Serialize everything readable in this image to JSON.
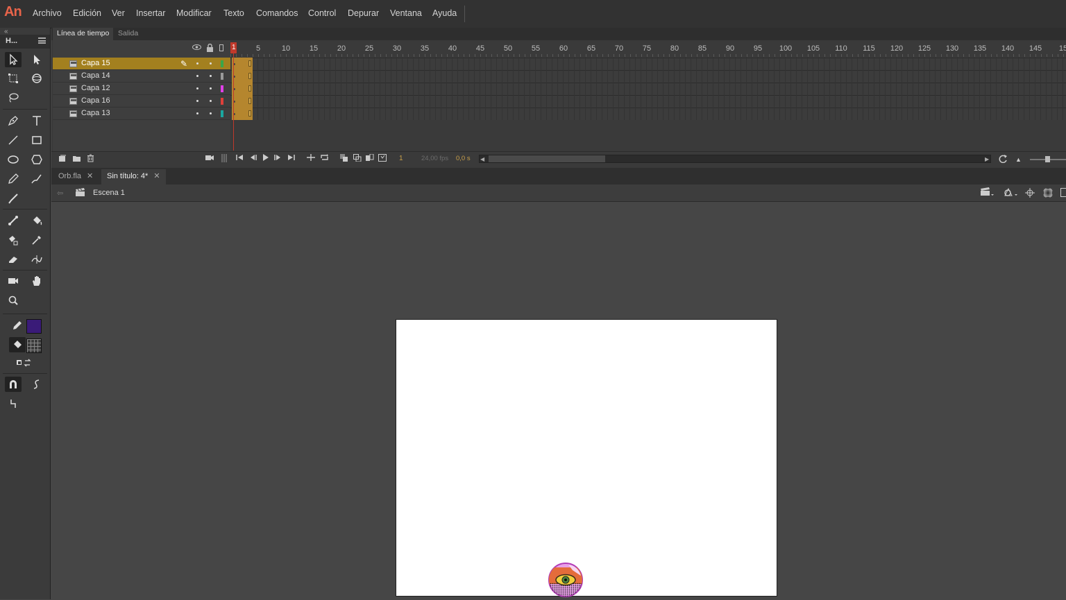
{
  "app": {
    "logo": "An"
  },
  "menu": [
    "Archivo",
    "Edición",
    "Ver",
    "Insertar",
    "Modificar",
    "Texto",
    "Comandos",
    "Control",
    "Depurar",
    "Ventana",
    "Ayuda"
  ],
  "tools_panel": {
    "title": "H..."
  },
  "timeline": {
    "tabs": [
      "Línea de tiempo",
      "Salida"
    ],
    "ruler": [
      "1",
      "5",
      "10",
      "15",
      "20",
      "25",
      "30",
      "35",
      "40",
      "45",
      "50",
      "55",
      "60",
      "65",
      "70",
      "75",
      "80",
      "85",
      "90",
      "95",
      "100",
      "105",
      "110",
      "115",
      "120",
      "125",
      "130",
      "135",
      "140",
      "145",
      "15"
    ],
    "layers": [
      {
        "name": "Capa 15",
        "color": "#3aa64a",
        "selected": true
      },
      {
        "name": "Capa 14",
        "color": "#9a9a9a",
        "selected": false
      },
      {
        "name": "Capa 12",
        "color": "#e040e8",
        "selected": false
      },
      {
        "name": "Capa 16",
        "color": "#e0403a",
        "selected": false
      },
      {
        "name": "Capa 13",
        "color": "#1aa7a0",
        "selected": false
      }
    ],
    "current_frame": "1",
    "fps": "24,00 fps",
    "time": "0,0 s"
  },
  "documents": {
    "tabs": [
      {
        "label": "Orb.fla",
        "active": false
      },
      {
        "label": "Sin título: 4*",
        "active": true
      }
    ],
    "scene": "Escena 1"
  },
  "colors": {
    "stroke": "#2a1a5e",
    "fill": "#3a1b78",
    "accent": "#a3801f"
  }
}
